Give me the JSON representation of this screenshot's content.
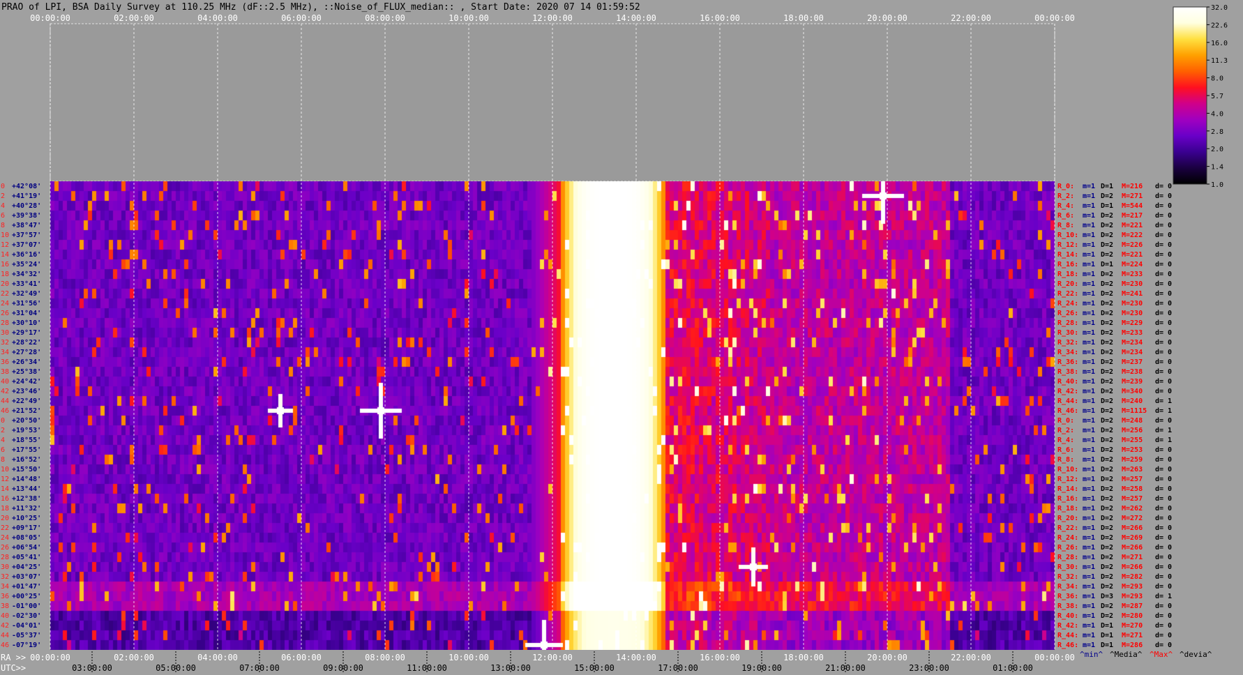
{
  "title": "PRAO of LPI, BSA Daily Survey at 110.25 MHz (dF::2.5 MHz), ::Noise_of_FLUX_median:: , Start Date: 2020 07 14 01:59:52",
  "chart_data": {
    "type": "heatmap",
    "top_time_ticks": [
      "00:00:00",
      "02:00:00",
      "04:00:00",
      "06:00:00",
      "08:00:00",
      "10:00:00",
      "12:00:00",
      "14:00:00",
      "16:00:00",
      "18:00:00",
      "20:00:00",
      "22:00:00",
      "00:00:00"
    ],
    "ra_prefix": "RA >>",
    "ra_ticks": [
      "00:00:00",
      "02:00:00",
      "04:00:00",
      "06:00:00",
      "08:00:00",
      "10:00:00",
      "12:00:00",
      "14:00:00",
      "16:00:00",
      "18:00:00",
      "20:00:00",
      "22:00:00",
      "00:00:00"
    ],
    "utc_prefix": "UTC>>",
    "utc_ticks": [
      "03:00:00",
      "05:00:00",
      "07:00:00",
      "09:00:00",
      "11:00:00",
      "13:00:00",
      "15:00:00",
      "17:00:00",
      "19:00:00",
      "21:00:00",
      "23:00:00",
      "01:00:00"
    ],
    "row_indices": [
      "0",
      "2",
      "4",
      "6",
      "8",
      "10",
      "12",
      "14",
      "16",
      "18",
      "20",
      "22",
      "24",
      "26",
      "28",
      "30",
      "32",
      "34",
      "36",
      "38",
      "40",
      "42",
      "44",
      "46",
      "0",
      "2",
      "4",
      "6",
      "8",
      "10",
      "12",
      "14",
      "16",
      "18",
      "20",
      "22",
      "24",
      "26",
      "28",
      "30",
      "32",
      "34",
      "36",
      "38",
      "40",
      "42",
      "44",
      "46"
    ],
    "declinations": [
      "+42°08'",
      "+41°19'",
      "+40°28'",
      "+39°38'",
      "+38°47'",
      "+37°57'",
      "+37°07'",
      "+36°16'",
      "+35°24'",
      "+34°32'",
      "+33°41'",
      "+32°49'",
      "+31°56'",
      "+31°04'",
      "+30°10'",
      "+29°17'",
      "+28°22'",
      "+27°28'",
      "+26°34'",
      "+25°38'",
      "+24°42'",
      "+23°46'",
      "+22°49'",
      "+21°52'",
      "+20°50'",
      "+19°53'",
      "+18°55'",
      "+17°55'",
      "+16°52'",
      "+15°50'",
      "+14°48'",
      "+13°44'",
      "+12°38'",
      "+11°32'",
      "+10°25'",
      "+09°17'",
      "+08°05'",
      "+06°54'",
      "+05°41'",
      "+04°25'",
      "+03°07'",
      "+01°47'",
      "+00°25'",
      "-01°00'",
      "-02°30'",
      "-04°01'",
      "-05°37'",
      "-07°19'"
    ],
    "stats": [
      {
        "r": "R_0:",
        "m": "m=1",
        "D": "D=1",
        "M": "M=216",
        "d": "d= 0"
      },
      {
        "r": "R_2:",
        "m": "m=1",
        "D": "D=2",
        "M": "M=271",
        "d": "d= 0"
      },
      {
        "r": "R_4:",
        "m": "m=1",
        "D": "D=1",
        "M": "M=544",
        "d": "d= 0"
      },
      {
        "r": "R_6:",
        "m": "m=1",
        "D": "D=2",
        "M": "M=217",
        "d": "d= 0"
      },
      {
        "r": "R_8:",
        "m": "m=1",
        "D": "D=2",
        "M": "M=221",
        "d": "d= 0"
      },
      {
        "r": "R_10:",
        "m": "m=1",
        "D": "D=2",
        "M": "M=222",
        "d": "d= 0"
      },
      {
        "r": "R_12:",
        "m": "m=1",
        "D": "D=2",
        "M": "M=226",
        "d": "d= 0"
      },
      {
        "r": "R_14:",
        "m": "m=1",
        "D": "D=2",
        "M": "M=221",
        "d": "d= 0"
      },
      {
        "r": "R_16:",
        "m": "m=1",
        "D": "D=1",
        "M": "M=224",
        "d": "d= 0"
      },
      {
        "r": "R_18:",
        "m": "m=1",
        "D": "D=2",
        "M": "M=233",
        "d": "d= 0"
      },
      {
        "r": "R_20:",
        "m": "m=1",
        "D": "D=2",
        "M": "M=230",
        "d": "d= 0"
      },
      {
        "r": "R_22:",
        "m": "m=1",
        "D": "D=2",
        "M": "M=241",
        "d": "d= 0"
      },
      {
        "r": "R_24:",
        "m": "m=1",
        "D": "D=2",
        "M": "M=230",
        "d": "d= 0"
      },
      {
        "r": "R_26:",
        "m": "m=1",
        "D": "D=2",
        "M": "M=230",
        "d": "d= 0"
      },
      {
        "r": "R_28:",
        "m": "m=1",
        "D": "D=2",
        "M": "M=229",
        "d": "d= 0"
      },
      {
        "r": "R_30:",
        "m": "m=1",
        "D": "D=2",
        "M": "M=233",
        "d": "d= 0"
      },
      {
        "r": "R_32:",
        "m": "m=1",
        "D": "D=2",
        "M": "M=234",
        "d": "d= 0"
      },
      {
        "r": "R_34:",
        "m": "m=1",
        "D": "D=2",
        "M": "M=234",
        "d": "d= 0"
      },
      {
        "r": "R_36:",
        "m": "m=1",
        "D": "D=2",
        "M": "M=237",
        "d": "d= 0"
      },
      {
        "r": "R_38:",
        "m": "m=1",
        "D": "D=2",
        "M": "M=238",
        "d": "d= 0"
      },
      {
        "r": "R_40:",
        "m": "m=1",
        "D": "D=2",
        "M": "M=239",
        "d": "d= 0"
      },
      {
        "r": "R_42:",
        "m": "m=1",
        "D": "D=2",
        "M": "M=340",
        "d": "d= 0"
      },
      {
        "r": "R_44:",
        "m": "m=1",
        "D": "D=2",
        "M": "M=240",
        "d": "d= 1"
      },
      {
        "r": "R_46:",
        "m": "m=1",
        "D": "D=2",
        "M": "M=1115",
        "d": "d= 1"
      },
      {
        "r": "R_0:",
        "m": "m=1",
        "D": "D=2",
        "M": "M=248",
        "d": "d= 0"
      },
      {
        "r": "R_2:",
        "m": "m=1",
        "D": "D=2",
        "M": "M=256",
        "d": "d= 1"
      },
      {
        "r": "R_4:",
        "m": "m=1",
        "D": "D=2",
        "M": "M=255",
        "d": "d= 1"
      },
      {
        "r": "R_6:",
        "m": "m=1",
        "D": "D=2",
        "M": "M=253",
        "d": "d= 0"
      },
      {
        "r": "R_8:",
        "m": "m=1",
        "D": "D=2",
        "M": "M=259",
        "d": "d= 0"
      },
      {
        "r": "R_10:",
        "m": "m=1",
        "D": "D=2",
        "M": "M=263",
        "d": "d= 0"
      },
      {
        "r": "R_12:",
        "m": "m=1",
        "D": "D=2",
        "M": "M=257",
        "d": "d= 0"
      },
      {
        "r": "R_14:",
        "m": "m=1",
        "D": "D=2",
        "M": "M=258",
        "d": "d= 0"
      },
      {
        "r": "R_16:",
        "m": "m=1",
        "D": "D=2",
        "M": "M=257",
        "d": "d= 0"
      },
      {
        "r": "R_18:",
        "m": "m=1",
        "D": "D=2",
        "M": "M=262",
        "d": "d= 0"
      },
      {
        "r": "R_20:",
        "m": "m=1",
        "D": "D=2",
        "M": "M=272",
        "d": "d= 0"
      },
      {
        "r": "R_22:",
        "m": "m=1",
        "D": "D=2",
        "M": "M=266",
        "d": "d= 0"
      },
      {
        "r": "R_24:",
        "m": "m=1",
        "D": "D=2",
        "M": "M=269",
        "d": "d= 0"
      },
      {
        "r": "R_26:",
        "m": "m=1",
        "D": "D=2",
        "M": "M=266",
        "d": "d= 0"
      },
      {
        "r": "R_28:",
        "m": "m=1",
        "D": "D=2",
        "M": "M=271",
        "d": "d= 0"
      },
      {
        "r": "R_30:",
        "m": "m=1",
        "D": "D=2",
        "M": "M=266",
        "d": "d= 0"
      },
      {
        "r": "R_32:",
        "m": "m=1",
        "D": "D=2",
        "M": "M=282",
        "d": "d= 0"
      },
      {
        "r": "R_34:",
        "m": "m=1",
        "D": "D=2",
        "M": "M=293",
        "d": "d= 0"
      },
      {
        "r": "R_36:",
        "m": "m=1",
        "D": "D=3",
        "M": "M=293",
        "d": "d= 1"
      },
      {
        "r": "R_38:",
        "m": "m=1",
        "D": "D=2",
        "M": "M=287",
        "d": "d= 0"
      },
      {
        "r": "R_40:",
        "m": "m=1",
        "D": "D=2",
        "M": "M=280",
        "d": "d= 0"
      },
      {
        "r": "R_42:",
        "m": "m=1",
        "D": "D=1",
        "M": "M=270",
        "d": "d= 0"
      },
      {
        "r": "R_44:",
        "m": "m=1",
        "D": "D=1",
        "M": "M=271",
        "d": "d= 0"
      },
      {
        "r": "R_46:",
        "m": "m=1",
        "D": "D=1",
        "M": "M=286",
        "d": "d= 0"
      }
    ],
    "stats_footer": [
      {
        "text": "^min^",
        "color": "#00008b"
      },
      {
        "text": "^Media^",
        "color": "#000000"
      },
      {
        "text": "^Max^",
        "color": "#ff0000"
      },
      {
        "text": "^devia^",
        "color": "#000000"
      }
    ],
    "colorbar": {
      "ticks": [
        "32.0",
        "22.6",
        "16.0",
        "11.3",
        "8.0",
        "5.7",
        "4.0",
        "2.8",
        "2.0",
        "1.4",
        "1.0"
      ],
      "range": [
        1.0,
        32.0
      ],
      "scale": "log"
    },
    "colormap": [
      "#000000",
      "#1a0040",
      "#3a0090",
      "#6a00c8",
      "#a000c0",
      "#d0008a",
      "#ff1020",
      "#ff6000",
      "#ffa000",
      "#ffe040",
      "#ffffe0",
      "#ffffff"
    ],
    "bright_band_ra_hours": [
      12.2,
      14.7
    ],
    "secondary_band_ra_hours": [
      14.1,
      17.2
    ],
    "sources": [
      {
        "ra_h": 19.9,
        "row": 1,
        "strength": 1.0
      },
      {
        "ra_h": 7.9,
        "row": 23,
        "strength": 1.0
      },
      {
        "ra_h": 5.5,
        "row": 23,
        "strength": 0.6
      },
      {
        "ra_h": 16.8,
        "row": 39,
        "strength": 0.7
      },
      {
        "ra_h": 11.8,
        "row": 47,
        "strength": 0.9
      }
    ]
  }
}
